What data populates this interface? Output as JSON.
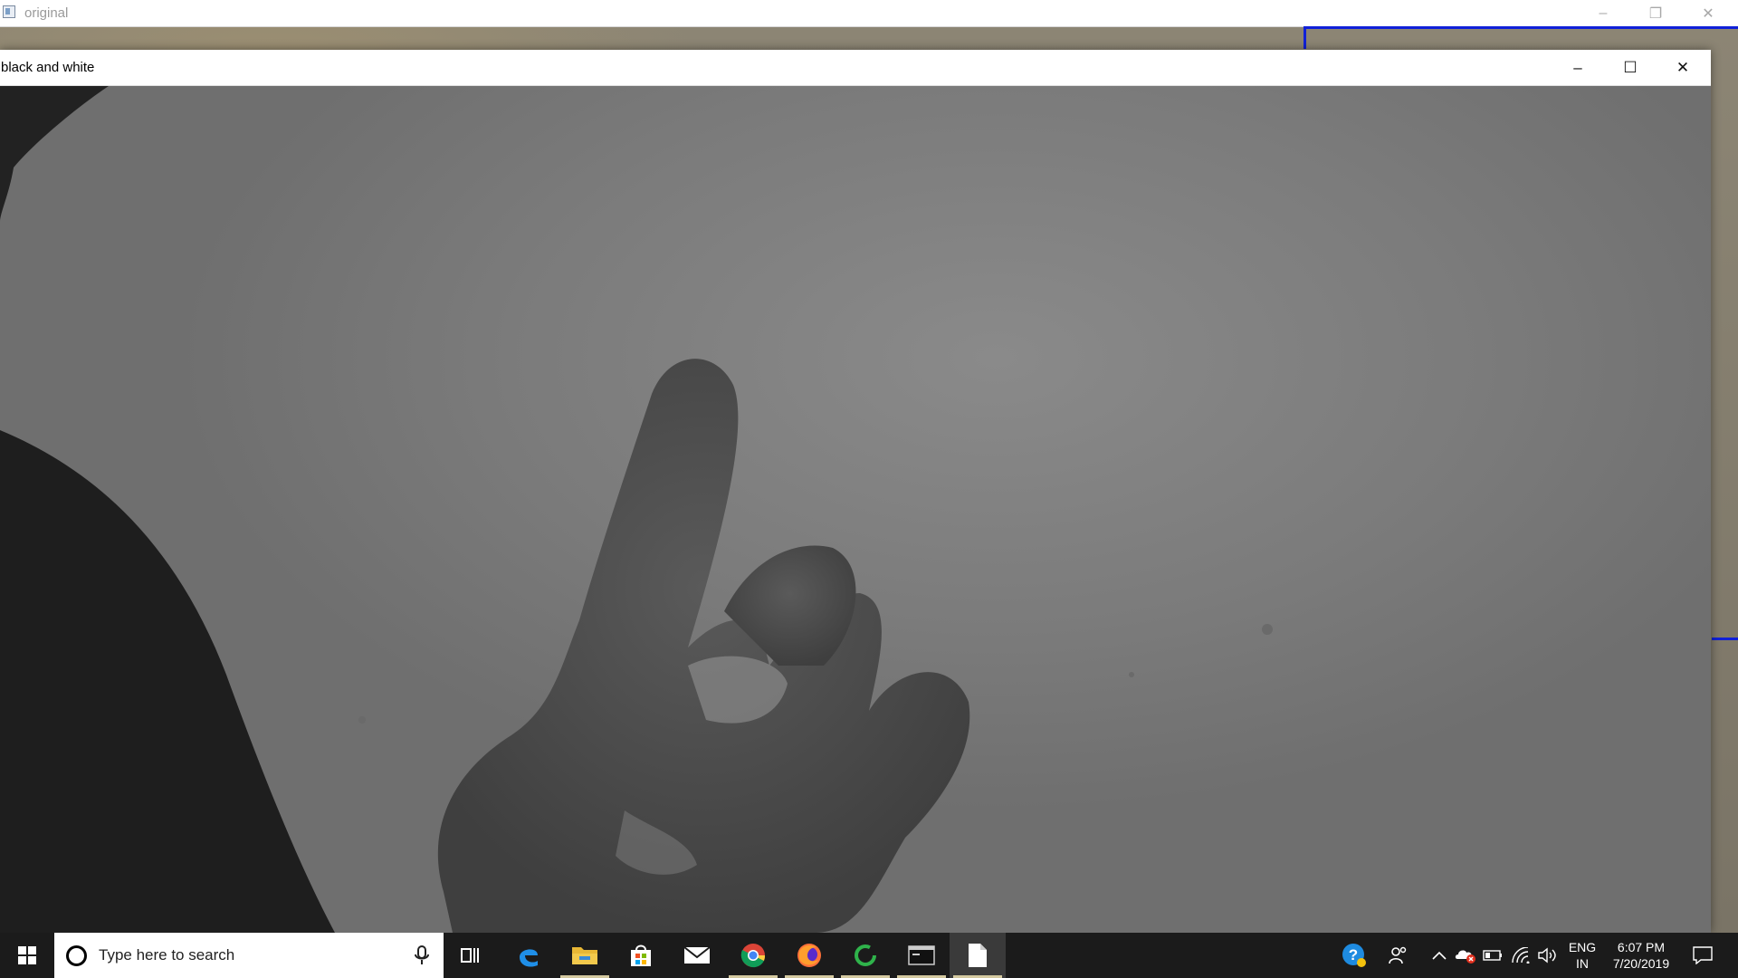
{
  "windows": {
    "original": {
      "title": "original",
      "controls": {
        "minimize": "–",
        "restore": "❐",
        "close": "✕"
      }
    },
    "black_and_white": {
      "title": "black and white",
      "controls": {
        "minimize": "–",
        "maximize": "☐",
        "close": "✕"
      }
    }
  },
  "taskbar": {
    "search": {
      "placeholder": "Type here to search"
    },
    "apps": [
      {
        "name": "task-view",
        "icon": "task-view-icon"
      },
      {
        "name": "edge",
        "icon": "edge-icon"
      },
      {
        "name": "file-explorer",
        "icon": "folder-icon"
      },
      {
        "name": "store",
        "icon": "store-icon"
      },
      {
        "name": "mail",
        "icon": "mail-icon"
      },
      {
        "name": "chrome",
        "icon": "chrome-icon"
      },
      {
        "name": "firefox",
        "icon": "firefox-icon"
      },
      {
        "name": "spinner-app",
        "icon": "circle-arrow-icon"
      },
      {
        "name": "console",
        "icon": "terminal-icon"
      },
      {
        "name": "document",
        "icon": "document-icon"
      }
    ],
    "tray": {
      "language_line1": "ENG",
      "language_line2": "IN",
      "time": "6:07 PM",
      "date": "7/20/2019"
    }
  },
  "colors": {
    "roi_box": "#1020d8",
    "taskbar": "#1b1b1b"
  }
}
